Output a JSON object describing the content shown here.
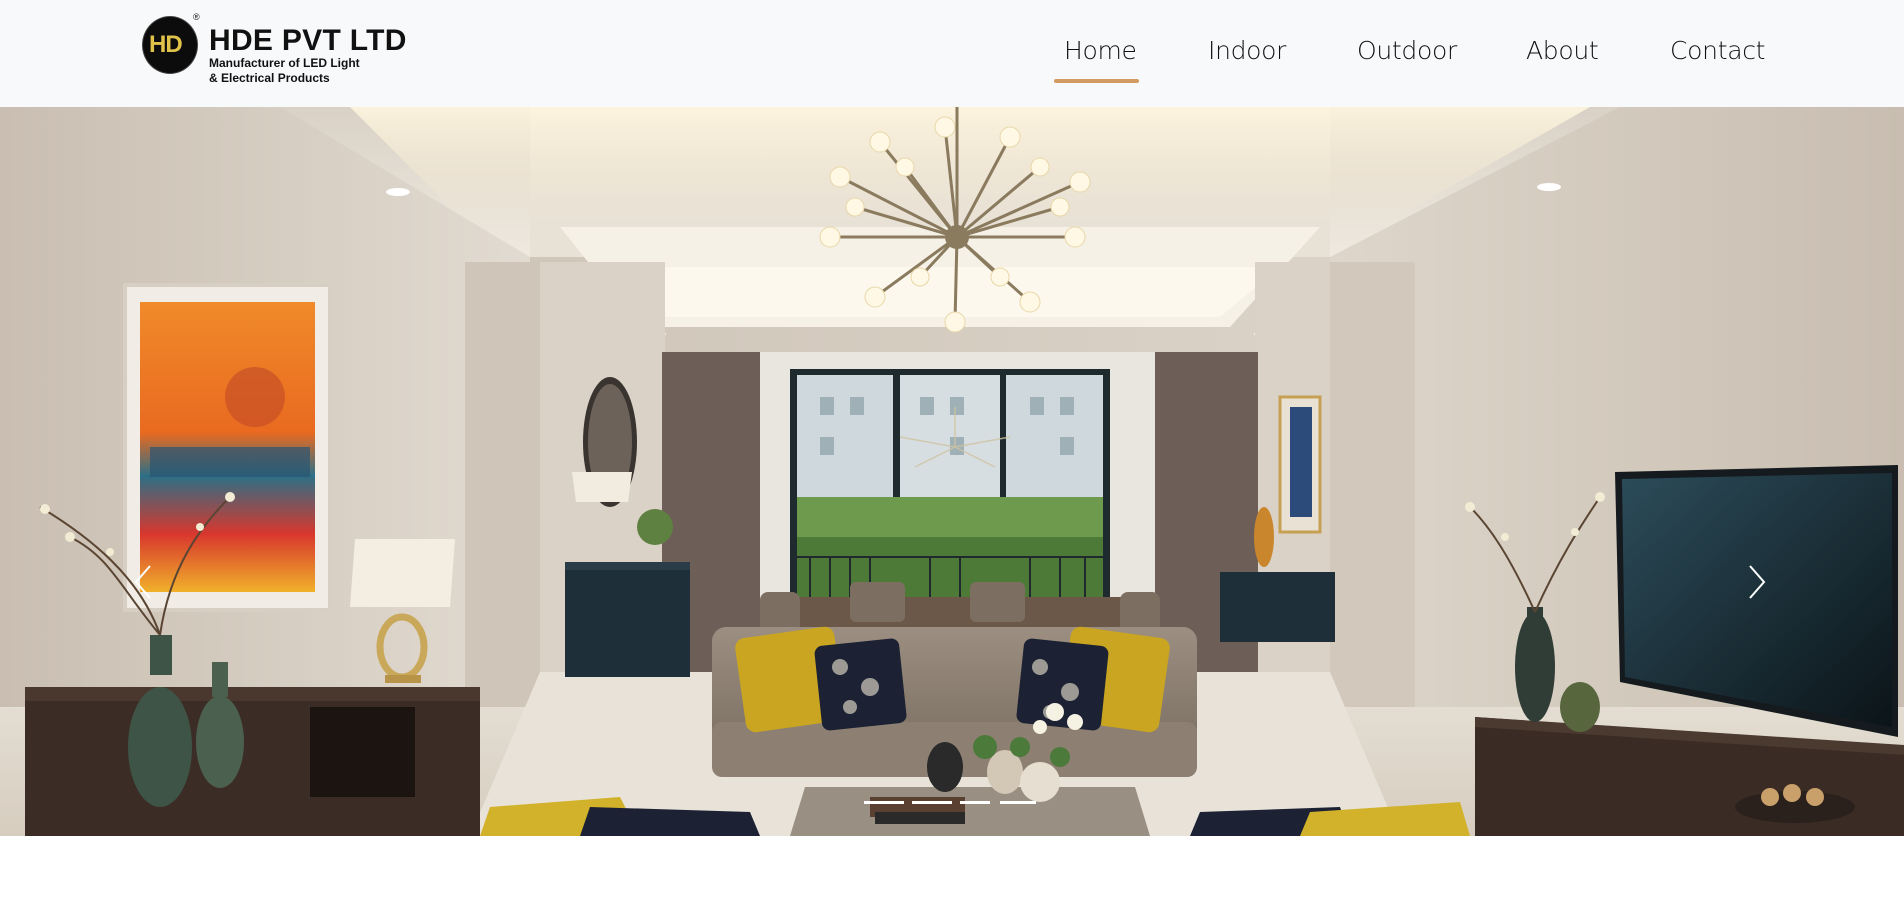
{
  "header": {
    "company_name": "HDE PVT LTD",
    "tagline_line1": "Manufacturer of LED Light",
    "tagline_line2": "& Electrical Products",
    "logo_letters": "HD",
    "logo_mark": "®"
  },
  "nav": {
    "items": [
      {
        "label": "Home",
        "active": true
      },
      {
        "label": "Indoor",
        "active": false
      },
      {
        "label": "Outdoor",
        "active": false
      },
      {
        "label": "About",
        "active": false
      },
      {
        "label": "Contact",
        "active": false
      }
    ],
    "active_color": "#d39b62"
  },
  "carousel": {
    "prev_icon": "chevron-left-icon",
    "next_icon": "chevron-right-icon",
    "slide_count": 4,
    "active_slide": 2,
    "image_subject": "living-room-with-chandelier"
  },
  "colors": {
    "header_bg": "#f8f9fa",
    "text": "#111111"
  }
}
